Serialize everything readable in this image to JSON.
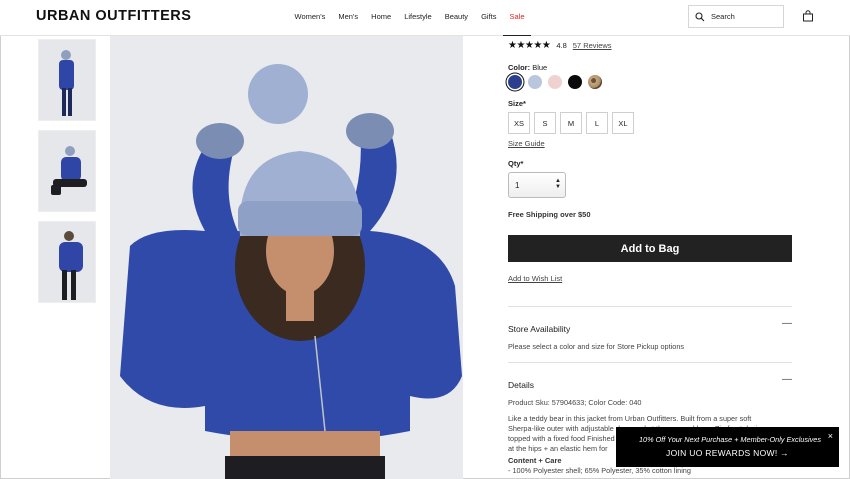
{
  "brand": {
    "logo_text": "URBAN OUTFITTERS"
  },
  "nav": {
    "items": [
      {
        "label": "Women's"
      },
      {
        "label": "Men's"
      },
      {
        "label": "Home"
      },
      {
        "label": "Lifestyle"
      },
      {
        "label": "Beauty"
      },
      {
        "label": "Gifts"
      },
      {
        "label": "Sale"
      }
    ],
    "search_label": "Search"
  },
  "product": {
    "stars": "★★★★★",
    "rating": "4.8",
    "reviews_label": "57 Reviews",
    "color_label": "Color:",
    "color_value": "Blue",
    "swatches": [
      {
        "name": "blue",
        "color": "#2b3f8f"
      },
      {
        "name": "light-blue",
        "color": "#b9c7de"
      },
      {
        "name": "pink",
        "color": "#efd2d0"
      },
      {
        "name": "black",
        "color": "#0a0a0a"
      },
      {
        "name": "leopard",
        "color": "#a48a68"
      }
    ],
    "size_label": "Size*",
    "sizes": [
      "XS",
      "S",
      "M",
      "L",
      "XL"
    ],
    "size_guide": "Size Guide",
    "qty_label": "Qty*",
    "qty_value": "1",
    "shipping": "Free Shipping over $50",
    "add_to_bag": "Add to Bag",
    "wish_list": "Add to Wish List"
  },
  "store": {
    "title": "Store Availability",
    "text": "Please select a color and size for Store Pickup options"
  },
  "details": {
    "title": "Details",
    "sku": "Product Sku: 57904633; Color Code: 040",
    "desc1": "Like a teddy bear in this jacket from Urban Outfitters. Built from a super soft",
    "desc2": "Sherpa-like outer with adjustable drawcord at the cropped hem. Zip-front design",
    "desc3": "topped with a fixed food Finished",
    "desc4": "at the hips + an elastic hem for",
    "content_title": "Content + Care",
    "content_line": "- 100% Polyester shell; 65% Polyester, 35% cotton lining"
  },
  "promo": {
    "line1": "10% Off Your Next Purchase + Member-Only Exclusives",
    "line2": "JOIN UO REWARDS NOW! →",
    "close": "×"
  }
}
